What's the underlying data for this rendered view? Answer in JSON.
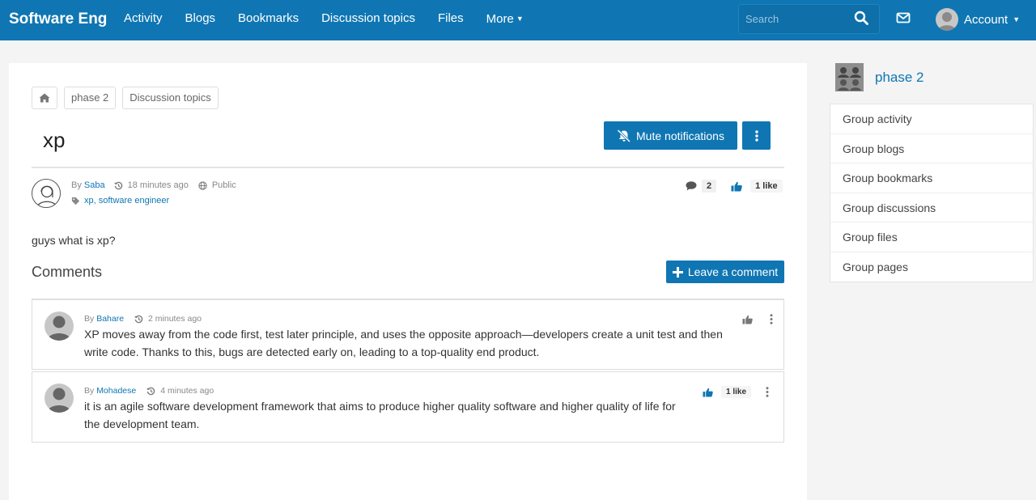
{
  "header": {
    "brand": "Software Eng",
    "nav": [
      "Activity",
      "Blogs",
      "Bookmarks",
      "Discussion topics",
      "Files",
      "More"
    ],
    "search_placeholder": "Search",
    "account_label": "Account"
  },
  "breadcrumb": {
    "items": [
      "phase 2",
      "Discussion topics"
    ]
  },
  "topic": {
    "title": "xp",
    "mute_label": "Mute notifications",
    "by_prefix": "By",
    "author": "Saba",
    "time": "18 minutes ago",
    "access": "Public",
    "tags": "xp, software engineer",
    "comment_count": "2",
    "likes": "1 like",
    "body": "guys what is xp?"
  },
  "comments_section": {
    "heading": "Comments",
    "leave_label": "Leave a comment",
    "items": [
      {
        "by_prefix": "By",
        "author": "Bahare",
        "time": "2 minutes ago",
        "text": "XP moves away from the code first, test later principle, and uses the opposite approach—developers create a unit test and then write code. Thanks to this, bugs are detected early on, leading to a top-quality end product.",
        "likes": ""
      },
      {
        "by_prefix": "By",
        "author": "Mohadese",
        "time": "4 minutes ago",
        "text": "it is an agile software development framework that aims to produce higher quality software and higher quality of life for the development team.",
        "likes": "1 like"
      }
    ]
  },
  "sidebar": {
    "group_name": "phase 2",
    "items": [
      "Group activity",
      "Group blogs",
      "Group bookmarks",
      "Group discussions",
      "Group files",
      "Group pages"
    ]
  },
  "colors": {
    "brand_blue": "#0f76b3",
    "page_bg": "#f4f4f4"
  }
}
